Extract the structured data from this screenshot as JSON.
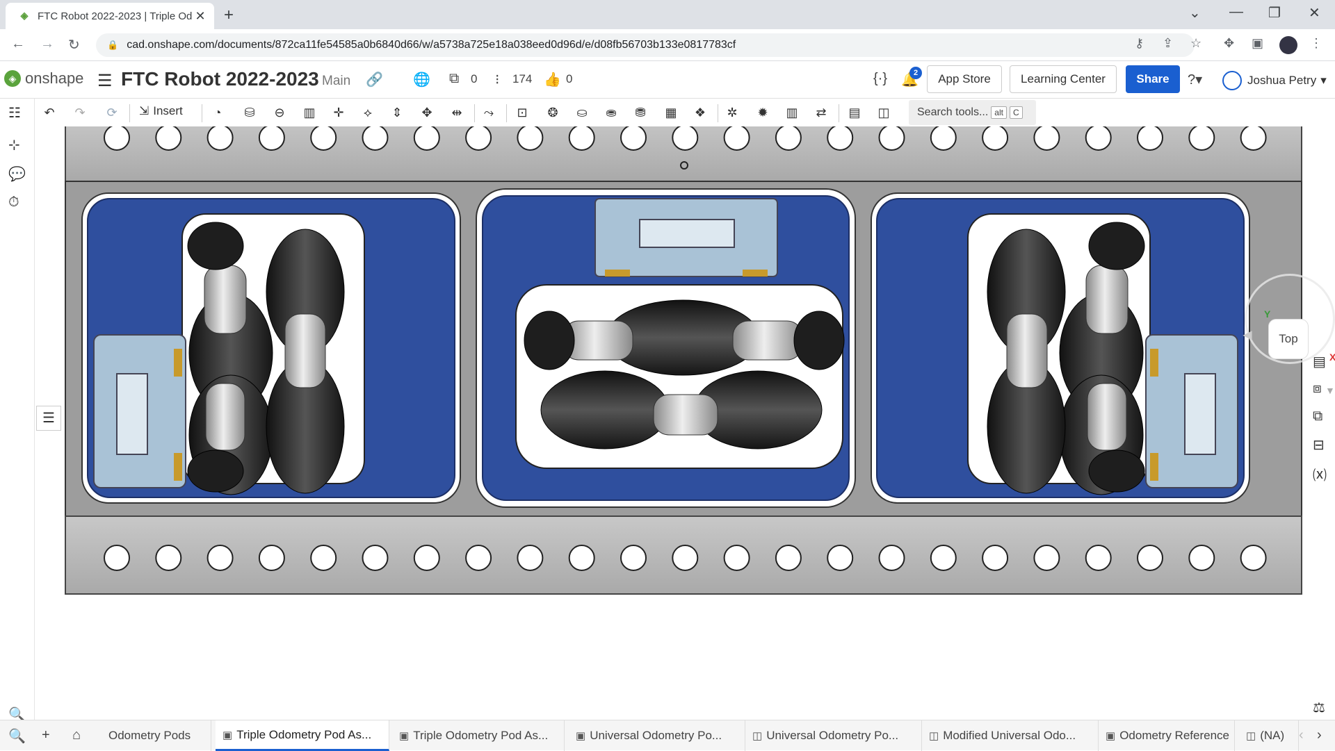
{
  "browser": {
    "tab_title": "FTC Robot 2022-2023 | Triple Od",
    "url": "cad.onshape.com/documents/872ca11fe54585a0b6840d66/w/a5738a725e18a038eed0d96d/e/d08fb56703b133e0817783cf"
  },
  "header": {
    "logo_text": "onshape",
    "doc_title": "FTC Robot 2022-2023",
    "branch": "Main",
    "versions_count": "0",
    "history_count": "174",
    "likes_count": "0",
    "notifications_count": "2",
    "app_store_label": "App Store",
    "learning_center_label": "Learning Center",
    "share_label": "Share",
    "user_name": "Joshua Petry",
    "accent_color": "#1a5fd0"
  },
  "toolbar": {
    "insert_label": "Insert",
    "search_placeholder": "Search tools...",
    "search_shortcut_1": "alt",
    "search_shortcut_2": "C"
  },
  "viewcube": {
    "face_label": "Top",
    "axis_x": "X",
    "axis_y": "Y"
  },
  "tabs": [
    {
      "label": "Odometry Pods"
    },
    {
      "label": "Triple Odometry Pod As..."
    },
    {
      "label": "Triple Odometry Pod As..."
    },
    {
      "label": "Universal Odometry Po..."
    },
    {
      "label": "Universal Odometry Po..."
    },
    {
      "label": "Modified Universal Odo..."
    },
    {
      "label": "Odometry Reference"
    },
    {
      "label": "(NA)"
    }
  ],
  "model_colors": {
    "plate": "#2f4f9e",
    "frame": "#b4b4b4",
    "wheel": "#2a2a2a",
    "roller": "#c0c0c0",
    "encoder": "#a9c2d6"
  }
}
